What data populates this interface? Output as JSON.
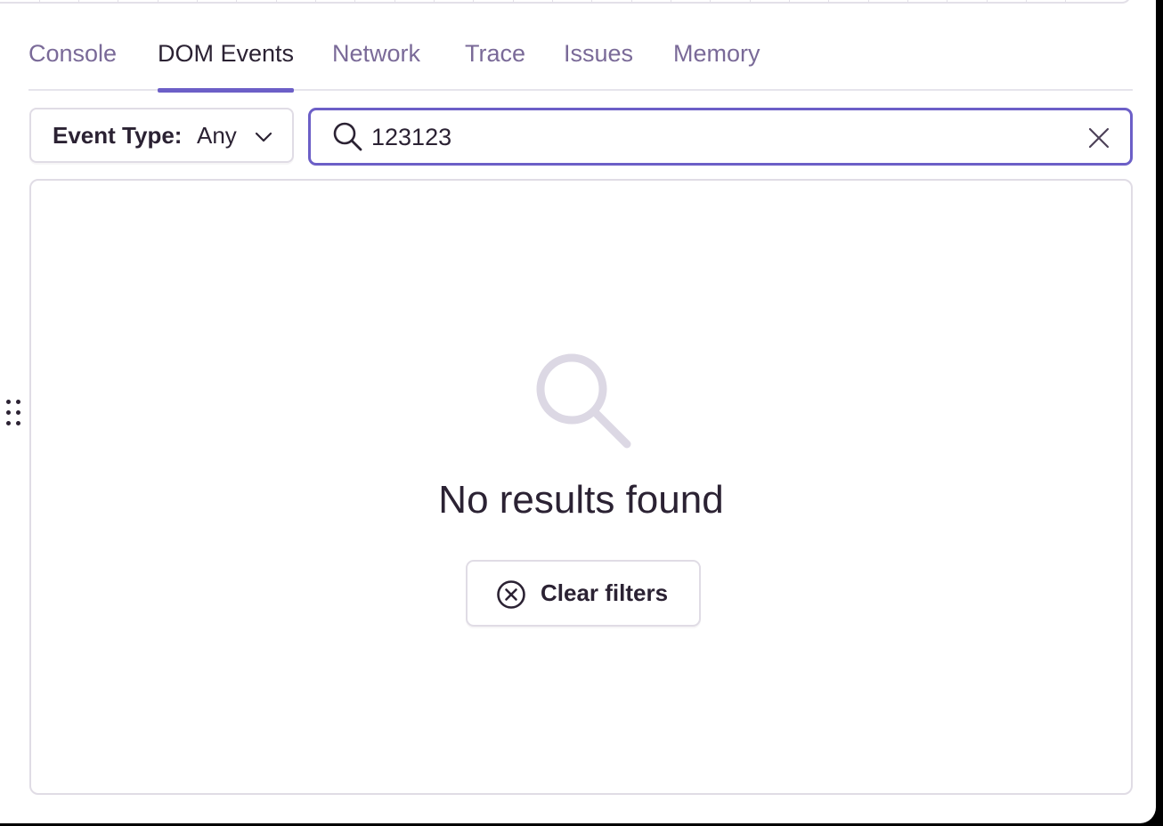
{
  "tabs": [
    {
      "label": "Console",
      "active": false
    },
    {
      "label": "DOM Events",
      "active": true
    },
    {
      "label": "Network",
      "active": false
    },
    {
      "label": "Trace",
      "active": false
    },
    {
      "label": "Issues",
      "active": false
    },
    {
      "label": "Memory",
      "active": false
    }
  ],
  "filter": {
    "label": "Event Type:",
    "value": "Any",
    "icon": "chevron-down-icon"
  },
  "search": {
    "value": "123123",
    "icon": "search-icon",
    "clear_icon": "close-icon"
  },
  "empty_state": {
    "icon": "search-icon",
    "message": "No results found",
    "button_label": "Clear filters",
    "button_icon": "circle-x-icon"
  },
  "colors": {
    "accent": "#6c5fc7",
    "text": "#2b2233",
    "muted_tab": "#7a6a98",
    "border": "#e0dce5",
    "empty_icon": "#dcd8e4"
  }
}
